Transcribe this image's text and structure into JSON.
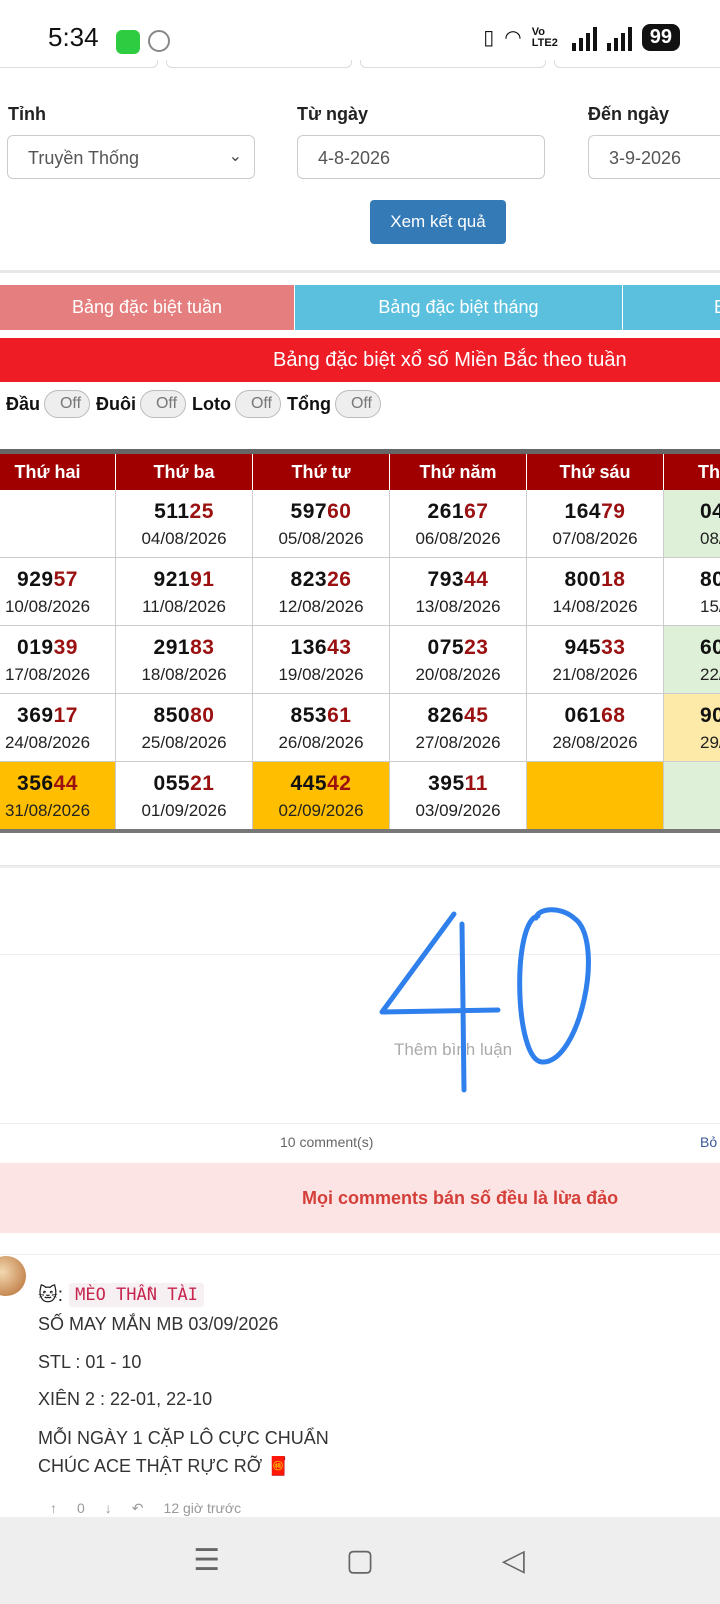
{
  "status_bar": {
    "time": "5:34",
    "network": "Vo LTE2",
    "battery": "99"
  },
  "form": {
    "province_label": "Tỉnh",
    "province_value": "Truyền Thống",
    "from_label": "Từ ngày",
    "from_value": "4-8-2026",
    "to_label": "Đến ngày",
    "to_value": "3-9-2026",
    "submit_label": "Xem kết quả"
  },
  "tabs": [
    {
      "label": "Bảng đặc biệt tuần",
      "color": "#e57f7f"
    },
    {
      "label": "Bảng đặc biệt tháng",
      "color": "#5bc0de"
    },
    {
      "label": "B",
      "color": "#5bc0de"
    }
  ],
  "banner": "Bảng đặc biệt xổ số Miền Bắc theo tuần",
  "toggles": [
    {
      "label": "Đầu",
      "state": "Off"
    },
    {
      "label": "Đuôi",
      "state": "Off"
    },
    {
      "label": "Loto",
      "state": "Off"
    },
    {
      "label": "Tổng",
      "state": "Off"
    }
  ],
  "table": {
    "headers": [
      "Thứ hai",
      "Thứ ba",
      "Thứ tư",
      "Thứ năm",
      "Thứ sáu",
      "Th"
    ],
    "rows": [
      [
        {
          "pre": "",
          "hl": "",
          "date": ""
        },
        {
          "pre": "511",
          "hl": "25",
          "date": "04/08/2026"
        },
        {
          "pre": "597",
          "hl": "60",
          "date": "05/08/2026"
        },
        {
          "pre": "261",
          "hl": "67",
          "date": "06/08/2026"
        },
        {
          "pre": "164",
          "hl": "79",
          "date": "07/08/2026"
        },
        {
          "pre": "04",
          "hl": "",
          "date": "08/0",
          "bg": "green"
        }
      ],
      [
        {
          "pre": "929",
          "hl": "57",
          "date": "10/08/2026"
        },
        {
          "pre": "921",
          "hl": "91",
          "date": "11/08/2026"
        },
        {
          "pre": "823",
          "hl": "26",
          "date": "12/08/2026"
        },
        {
          "pre": "793",
          "hl": "44",
          "date": "13/08/2026"
        },
        {
          "pre": "800",
          "hl": "18",
          "date": "14/08/2026"
        },
        {
          "pre": "80",
          "hl": "",
          "date": "15/0"
        }
      ],
      [
        {
          "pre": "019",
          "hl": "39",
          "date": "17/08/2026"
        },
        {
          "pre": "291",
          "hl": "83",
          "date": "18/08/2026"
        },
        {
          "pre": "136",
          "hl": "43",
          "date": "19/08/2026"
        },
        {
          "pre": "075",
          "hl": "23",
          "date": "20/08/2026"
        },
        {
          "pre": "945",
          "hl": "33",
          "date": "21/08/2026"
        },
        {
          "pre": "60",
          "hl": "",
          "date": "22/0",
          "bg": "green"
        }
      ],
      [
        {
          "pre": "369",
          "hl": "17",
          "date": "24/08/2026"
        },
        {
          "pre": "850",
          "hl": "80",
          "date": "25/08/2026"
        },
        {
          "pre": "853",
          "hl": "61",
          "date": "26/08/2026"
        },
        {
          "pre": "826",
          "hl": "45",
          "date": "27/08/2026"
        },
        {
          "pre": "061",
          "hl": "68",
          "date": "28/08/2026"
        },
        {
          "pre": "90",
          "hl": "",
          "date": "29/0",
          "bg": "yellow"
        }
      ],
      [
        {
          "pre": "356",
          "hl": "44",
          "date": "31/08/2026",
          "bg": "gold"
        },
        {
          "pre": "055",
          "hl": "21",
          "date": "01/09/2026"
        },
        {
          "pre": "445",
          "hl": "42",
          "date": "02/09/2026",
          "bg": "gold"
        },
        {
          "pre": "395",
          "hl": "11",
          "date": "03/09/2026"
        },
        {
          "pre": "",
          "hl": "",
          "date": "",
          "bg": "gold"
        },
        {
          "pre": "",
          "hl": "",
          "date": "",
          "bg": "green"
        }
      ]
    ]
  },
  "comments": {
    "placeholder": "Thêm bình luận",
    "count_text": "10 comment(s)",
    "sort_text": "Bỏ",
    "warning": "Mọi comments bán số đều là lừa đảo",
    "handwritten_overlay": "40",
    "first": {
      "author_emoji": "🐱:",
      "author_name": "MÈO THẦN TÀI",
      "lines": [
        "SỐ MAY MẮN MB 03/09/2026",
        "STL : 01 - 10",
        "XIÊN 2 : 22-01, 22-10",
        "MỖI NGÀY 1 CẶP LÔ CỰC CHUẨN",
        "CHÚC ACE THẬT RỰC RỠ 🧧"
      ],
      "votes": "0",
      "time": "12 giờ trước"
    }
  }
}
